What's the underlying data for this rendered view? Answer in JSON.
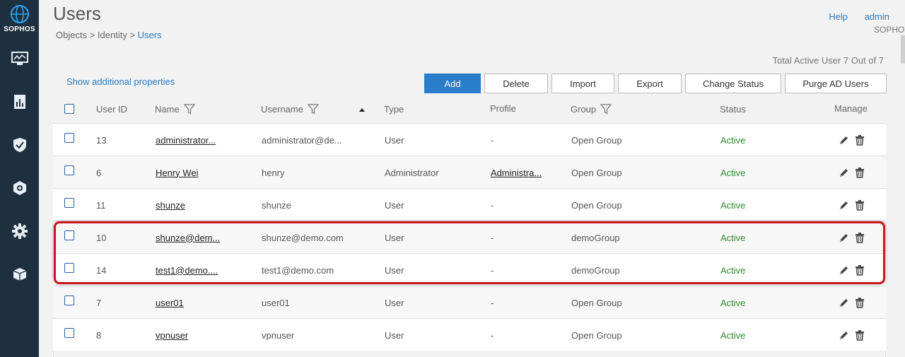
{
  "brand": {
    "name": "SOPHOS"
  },
  "sidebar": {
    "items": [
      {
        "icon": "monitor-icon"
      },
      {
        "icon": "report-icon"
      },
      {
        "icon": "shield-icon"
      },
      {
        "icon": "protection-icon"
      },
      {
        "icon": "gear-icon"
      },
      {
        "icon": "box-icon"
      }
    ]
  },
  "header": {
    "title": "Users",
    "breadcrumb": {
      "part1": "Objects",
      "sep1": " > ",
      "part2": "Identity",
      "sep2": " > ",
      "current": "Users"
    },
    "help": "Help",
    "user": "admin",
    "org": "SOPHOS"
  },
  "summary": {
    "total": "Total Active User 7 Out of 7"
  },
  "show_additional": "Show additional properties",
  "toolbar": {
    "add": "Add",
    "delete": "Delete",
    "import": "Import",
    "export": "Export",
    "change_status": "Change Status",
    "purge": "Purge AD Users"
  },
  "columns": {
    "user_id": "User ID",
    "name": "Name",
    "username": "Username",
    "type": "Type",
    "profile": "Profile",
    "group": "Group",
    "status": "Status",
    "manage": "Manage"
  },
  "rows": [
    {
      "id": "13",
      "name": "administrator...",
      "username": "administrator@de...",
      "type": "User",
      "profile": "-",
      "group": "Open Group",
      "status": "Active"
    },
    {
      "id": "6",
      "name": "Henry Wei",
      "username": "henry",
      "type": "Administrator",
      "profile": "Administra...",
      "group": "Open Group",
      "status": "Active"
    },
    {
      "id": "11",
      "name": "shunze",
      "username": "shunze",
      "type": "User",
      "profile": "-",
      "group": "Open Group",
      "status": "Active"
    },
    {
      "id": "10",
      "name": "shunze@dem...",
      "username": "shunze@demo.com",
      "type": "User",
      "profile": "-",
      "group": "demoGroup",
      "status": "Active"
    },
    {
      "id": "14",
      "name": "test1@demo....",
      "username": "test1@demo.com",
      "type": "User",
      "profile": "-",
      "group": "demoGroup",
      "status": "Active"
    },
    {
      "id": "7",
      "name": "user01",
      "username": "user01",
      "type": "User",
      "profile": "-",
      "group": "Open Group",
      "status": "Active"
    },
    {
      "id": "8",
      "name": "vpnuser",
      "username": "vpnuser",
      "type": "User",
      "profile": "-",
      "group": "Open Group",
      "status": "Active"
    }
  ],
  "colors": {
    "sidebar": "#1e3040",
    "accent": "#2a7dc9",
    "active": "#2e8b2e",
    "highlight": "#c9191d"
  }
}
